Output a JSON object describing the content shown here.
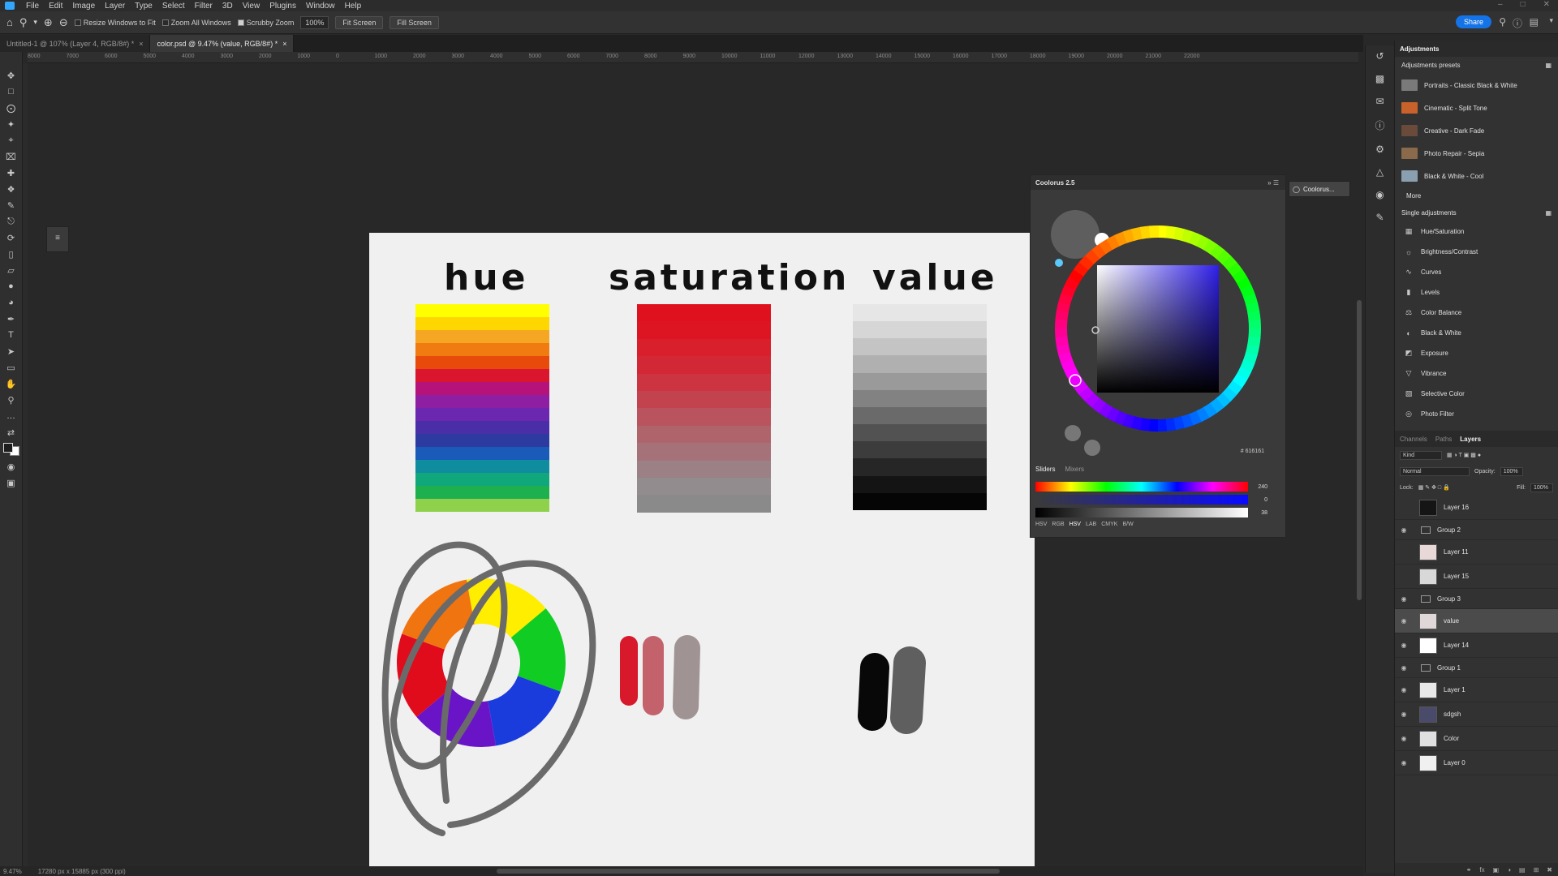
{
  "app": {
    "menu": [
      "File",
      "Edit",
      "Image",
      "Layer",
      "Type",
      "Select",
      "Filter",
      "3D",
      "View",
      "Plugins",
      "Window",
      "Help"
    ]
  },
  "options_bar": {
    "resize_windows": "Resize Windows to Fit",
    "zoom_all": "Zoom All Windows",
    "scrubby_zoom": "Scrubby Zoom",
    "zoom_value": "100%",
    "fit_screen": "Fit Screen",
    "fill_screen": "Fill Screen",
    "share": "Share"
  },
  "tabs": [
    {
      "label": "Untitled-1 @ 107% (Layer 4, RGB/8#) *",
      "active": false
    },
    {
      "label": "color.psd @ 9.47% (value, RGB/8#) *",
      "active": true
    }
  ],
  "ruler": [
    "8000",
    "7000",
    "6000",
    "5000",
    "4000",
    "3000",
    "2000",
    "1000",
    "0",
    "1000",
    "2000",
    "3000",
    "4000",
    "5000",
    "6000",
    "7000",
    "8000",
    "9000",
    "10000",
    "11000",
    "12000",
    "13000",
    "14000",
    "15000",
    "16000",
    "17000",
    "18000",
    "19000",
    "20000",
    "21000",
    "22000"
  ],
  "document": {
    "headings": {
      "hue": "hue",
      "saturation": "saturation",
      "value": "value"
    },
    "hue_stripes": [
      "#ffff00",
      "#ffd700",
      "#f5a623",
      "#f07b10",
      "#e84a0c",
      "#d9162e",
      "#b5127a",
      "#8e1fa3",
      "#6b27b0",
      "#4a2ea8",
      "#2d3aa0",
      "#1a5ab8",
      "#0f8c9e",
      "#10a87a",
      "#1eb04e",
      "#8fd14a"
    ],
    "saturation_stripes": [
      "#e0111e",
      "#dd1522",
      "#d81f2b",
      "#d22835",
      "#cb3440",
      "#c2434e",
      "#b9535d",
      "#af646c",
      "#a6727a",
      "#9b8085",
      "#938c8f",
      "#8a8a8a"
    ],
    "value_stripes": [
      "#e6e6e6",
      "#d6d6d6",
      "#c4c4c4",
      "#b0b0b0",
      "#9a9a9a",
      "#828282",
      "#6a6a6a",
      "#525252",
      "#3c3c3c",
      "#262626",
      "#141414",
      "#050505"
    ],
    "wheel_colors": [
      "#ffee00",
      "#11cc22",
      "#1a3cdc",
      "#6a14c8",
      "#e00b1b",
      "#f07410"
    ]
  },
  "coolorus": {
    "title": "Coolorus 2.5",
    "tab_label": "Coolorus...",
    "hex": "# 616161",
    "slider_tabs": [
      "Sliders",
      "Mixers"
    ],
    "slider_values": [
      "240",
      "0",
      "38"
    ],
    "modes": [
      "HSV",
      "RGB",
      "HSV",
      "LAB",
      "CMYK",
      "B/W"
    ]
  },
  "adjustments": {
    "panel_title": "Adjustments",
    "presets_title": "Adjustments presets",
    "presets": [
      {
        "label": "Portraits - Classic Black & White",
        "color": "#7a7a7a"
      },
      {
        "label": "Cinematic - Split Tone",
        "color": "#c8622a"
      },
      {
        "label": "Creative - Dark Fade",
        "color": "#6a4a3a"
      },
      {
        "label": "Photo Repair - Sepia",
        "color": "#8a6a4a"
      },
      {
        "label": "Black & White - Cool",
        "color": "#8aa0b0"
      }
    ],
    "more": "More",
    "single_title": "Single adjustments",
    "single": [
      {
        "label": "Hue/Saturation",
        "icon": "hue-saturation-icon"
      },
      {
        "label": "Brightness/Contrast",
        "icon": "brightness-icon"
      },
      {
        "label": "Curves",
        "icon": "curves-icon"
      },
      {
        "label": "Levels",
        "icon": "levels-icon"
      },
      {
        "label": "Color Balance",
        "icon": "color-balance-icon"
      },
      {
        "label": "Black & White",
        "icon": "black-white-icon"
      },
      {
        "label": "Exposure",
        "icon": "exposure-icon"
      },
      {
        "label": "Vibrance",
        "icon": "vibrance-icon"
      },
      {
        "label": "Selective Color",
        "icon": "selective-color-icon"
      },
      {
        "label": "Photo Filter",
        "icon": "photo-filter-icon"
      }
    ]
  },
  "layers_panel": {
    "tabs": [
      "Channels",
      "Paths",
      "Layers"
    ],
    "kind": "Kind",
    "blend_mode": "Normal",
    "opacity_label": "Opacity:",
    "opacity": "100%",
    "lock_label": "Lock:",
    "fill_label": "Fill:",
    "fill": "100%",
    "layers": [
      {
        "name": "Layer 16",
        "type": "layer",
        "visible": false,
        "thumb": "#151515"
      },
      {
        "name": "Group 2",
        "type": "group",
        "visible": true
      },
      {
        "name": "Layer 11",
        "type": "layer",
        "visible": false,
        "thumb": "#e8d8d8"
      },
      {
        "name": "Layer 15",
        "type": "layer",
        "visible": false,
        "thumb": "#d8d8d8"
      },
      {
        "name": "Group 3",
        "type": "group",
        "visible": true
      },
      {
        "name": "value",
        "type": "layer",
        "visible": true,
        "thumb": "#e0d8d8",
        "selected": true
      },
      {
        "name": "Layer 14",
        "type": "layer",
        "visible": true,
        "thumb": "#ffffff"
      },
      {
        "name": "Group 1",
        "type": "group",
        "visible": true
      },
      {
        "name": "Layer 1",
        "type": "layer",
        "visible": true,
        "thumb": "#e8e8e8"
      },
      {
        "name": "sdgsh",
        "type": "layer",
        "visible": true,
        "thumb": "#4a4a6a"
      },
      {
        "name": "Color",
        "type": "layer",
        "visible": true,
        "thumb": "#e0e0e0"
      },
      {
        "name": "Layer 0",
        "type": "layer",
        "visible": true,
        "thumb": "#f0f0f0"
      }
    ]
  },
  "status": {
    "zoom": "9.47%",
    "size": "17280 px x 15885 px (300 ppi)"
  }
}
